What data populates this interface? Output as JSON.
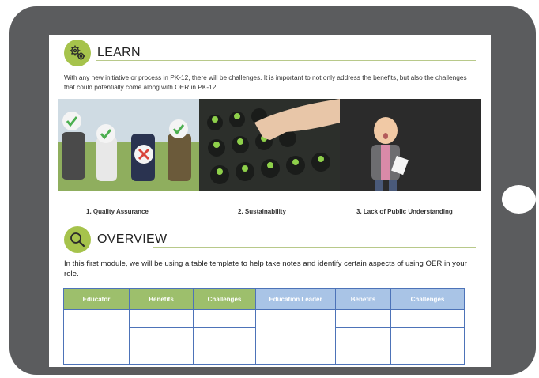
{
  "learn": {
    "title": "LEARN",
    "icon": "gears-icon",
    "intro": "With any new initiative or process in PK-12, there will be challenges. It is important to not only address the benefits, but also the challenges that could potentially come along with OER in PK-12."
  },
  "captions": [
    "1. Quality Assurance",
    "2. Sustainability",
    "3. Lack of Public Understanding"
  ],
  "overview": {
    "title": "OVERVIEW",
    "icon": "magnifier-icon",
    "text": "In this first module, we will be using a table template to help take notes and identify certain aspects of using OER in your role."
  },
  "table": {
    "headers": [
      "Educator",
      "Benefits",
      "Challenges",
      "Education Leader",
      "Benefits",
      "Challenges"
    ]
  },
  "colors": {
    "accent_green": "#a6c34c",
    "table_green": "#9dbf6c",
    "table_blue": "#a9c4e6",
    "tablet_frame": "#5b5c5e"
  }
}
